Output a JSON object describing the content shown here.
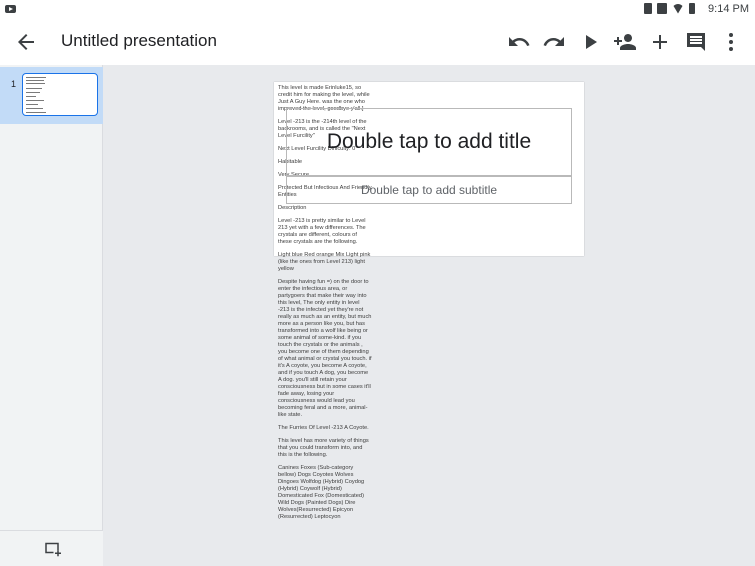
{
  "status_bar": {
    "time": "9:14 PM"
  },
  "toolbar": {
    "title": "Untitled presentation",
    "icons": [
      "back-arrow-icon",
      "undo-icon",
      "redo-icon",
      "play-icon",
      "add-person-icon",
      "plus-icon",
      "comment-icon",
      "more-vert-icon"
    ]
  },
  "sidebar": {
    "slides": [
      {
        "number": "1"
      }
    ],
    "new_slide_icon": "add-slide-icon"
  },
  "slide": {
    "title_placeholder": "Double tap to add title",
    "subtitle_placeholder": "Double tap to add subtitle"
  },
  "overflow_text": [
    "This level is made Erinluke15, so credit him for making the level, while Just A Guy Here. was the one who improved the level, goodbye y'all.]",
    "Level -213 is the -214th level of the backrooms, and is called the \"Next Level Furcility\"",
    "Next Level Furcility Difficulty: 0",
    "Habitable",
    "Very Secure",
    "Protected But Infectious And Friendly Entities",
    "Description",
    "Level -213 is pretty similar to Level 213 yet with a few differences. The crystals are different, colours of these crystals are the following.",
    "Light blue Red orange Mix Light pink (like the ones from Level 213) light yellow",
    "Despite having fun =) on the door to enter the infectious area, or partygoers that make their way into this level, The only entity in level -213 is the infected yet they're not really as much as an entity, but much more as a person like you, but has transformed into a wolf like being or some animal of some-kind. if you touch the crystals or the animals , you become one of them depending of what animal or crystal you touch. if it's A coyote, you become A coyote, and if you touch A dog, you become A dog. you'll still retain your consciousness but in some cases it'll fade away, losing your consciousness would lead you becoming feral and a more, animal-like state.",
    "The Furries Of Level -213 A Coyote.",
    "This level has more variety of things that you could transform into, and this is the following.",
    "Canines Foxes (Sub-category bellow) Dogs Coyotes Wolves Dingoes Wolfdog (Hybrid) Coydog (Hybrid) Coywolf (Hybrid) Domesticated Fox (Domesticated) Wild Dogs (Painted Dogs) Dire Wolves(Resurrected) Epicyon (Resurrected) Leptocyon"
  ]
}
